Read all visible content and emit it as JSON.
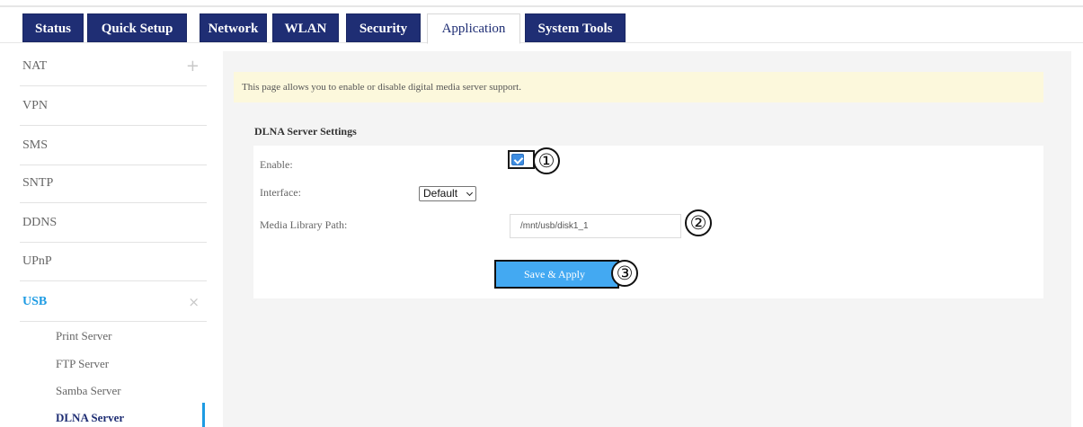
{
  "tabs": [
    {
      "label": "Status",
      "active": false
    },
    {
      "label": "Quick Setup",
      "active": false
    },
    {
      "label": "Network",
      "active": false
    },
    {
      "label": "WLAN",
      "active": false
    },
    {
      "label": "Security",
      "active": false
    },
    {
      "label": "Application",
      "active": true
    },
    {
      "label": "System Tools",
      "active": false
    }
  ],
  "sidebar": {
    "items": [
      {
        "label": "NAT",
        "sign": "+"
      },
      {
        "label": "VPN"
      },
      {
        "label": "SMS"
      },
      {
        "label": "SNTP"
      },
      {
        "label": "DDNS"
      },
      {
        "label": "UPnP"
      },
      {
        "label": "USB",
        "sign": "×",
        "expanded": true
      }
    ],
    "sub_items": [
      {
        "label": "Print Server"
      },
      {
        "label": "FTP Server"
      },
      {
        "label": "Samba Server"
      },
      {
        "label": "DLNA Server",
        "active": true
      }
    ]
  },
  "main": {
    "notice": "This page allows you to enable or disable digital media server support.",
    "section_title": "DLNA Server Settings",
    "enable_label": "Enable:",
    "enable_checked": true,
    "interface_label": "Interface:",
    "interface_value": "Default",
    "media_path_label": "Media Library Path:",
    "media_path_value": "/mnt/usb/disk1_1",
    "save_button": "Save & Apply"
  },
  "callouts": [
    "①",
    "②",
    "③"
  ],
  "colors": {
    "tab_bg": "#1f2e74",
    "accent_blue": "#1d9be3",
    "button_bg": "#43a9f2",
    "notice_bg": "#fcf8dc",
    "checkbox": "#3f8ee2"
  }
}
